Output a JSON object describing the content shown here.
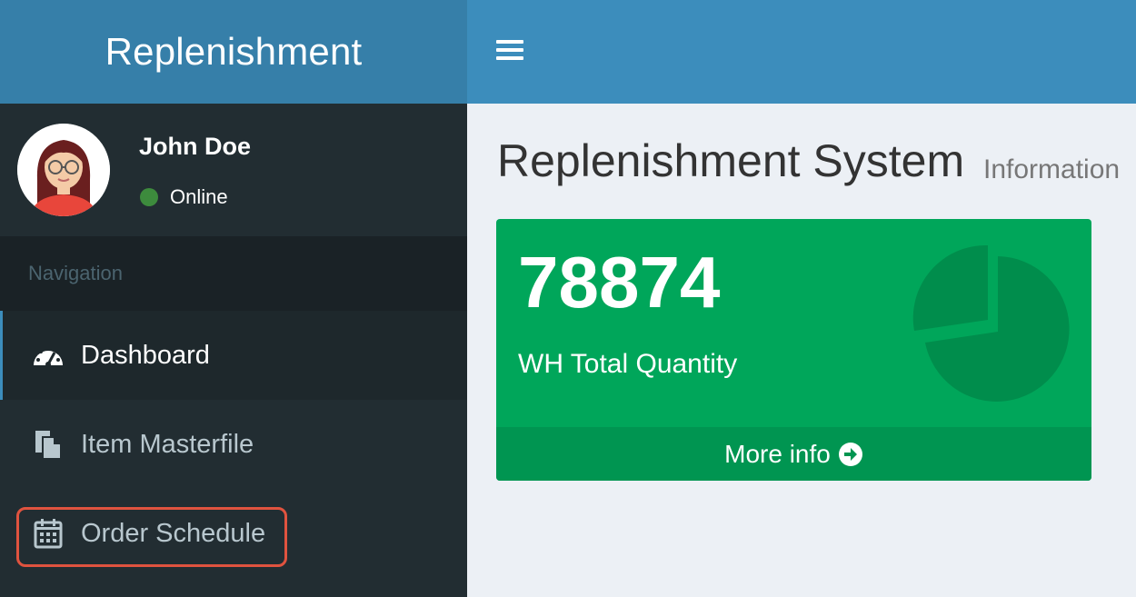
{
  "header": {
    "app_title": "Replenishment",
    "toggle_icon": "hamburger-icon",
    "colors": {
      "logo_bg": "#367fa9",
      "navbar_bg": "#3c8dbc"
    }
  },
  "user": {
    "name": "John Doe",
    "status": "Online",
    "status_color": "#3d8b3d",
    "avatar_icon": "user-avatar-icon"
  },
  "sidebar": {
    "header": "Navigation",
    "items": [
      {
        "label": "Dashboard",
        "icon": "dashboard-icon",
        "active": true
      },
      {
        "label": "Item Masterfile",
        "icon": "files-icon",
        "active": false
      },
      {
        "label": "Order Schedule",
        "icon": "calendar-icon",
        "active": false,
        "highlighted": true
      }
    ]
  },
  "content": {
    "title": "Replenishment System",
    "subtitle": "Information",
    "stat_box": {
      "value": "78874",
      "label": "WH Total Quantity",
      "icon": "pie-chart-icon",
      "footer": "More info",
      "footer_icon": "arrow-circle-right-icon",
      "color": "#00a65a"
    }
  }
}
